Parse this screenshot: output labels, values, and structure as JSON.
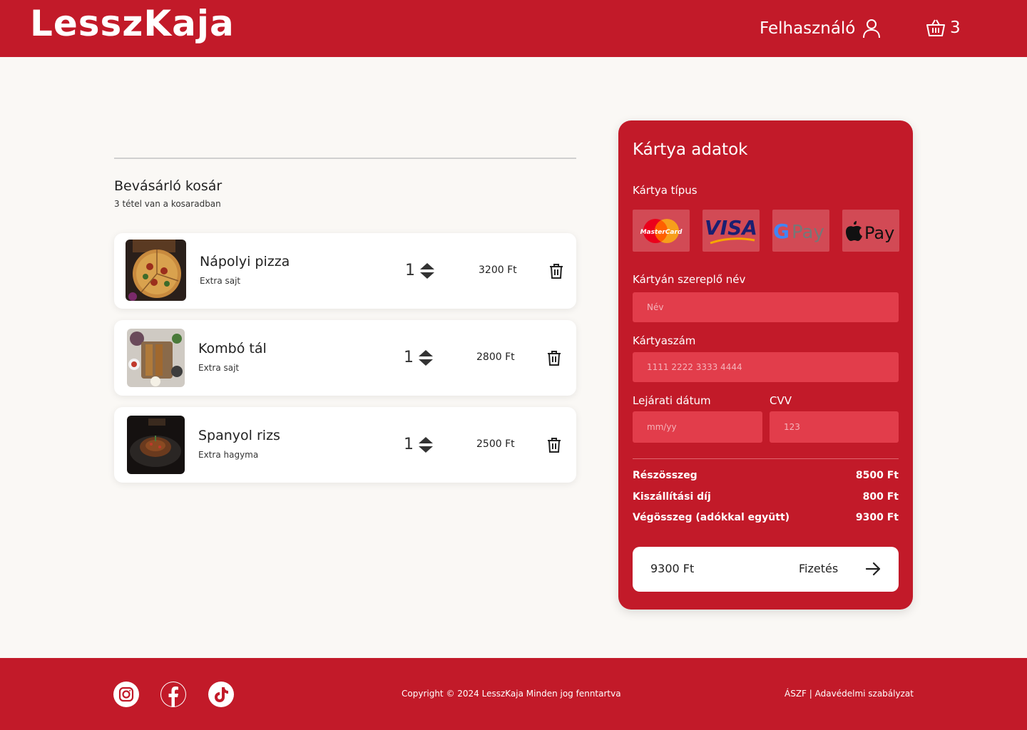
{
  "header": {
    "logo": "LesszKaja",
    "user_label": "Felhasználó",
    "cart_count": "3"
  },
  "cart": {
    "title": "Bevásárló kosár",
    "subtitle": "3 tétel van a kosaradban",
    "items": [
      {
        "name": "Nápolyi pizza",
        "extra": "Extra sajt",
        "qty": "1",
        "price": "3200 Ft",
        "image": "pizza-image"
      },
      {
        "name": "Kombó tál",
        "extra": "Extra sajt",
        "qty": "1",
        "price": "2800 Ft",
        "image": "combo-platter-image"
      },
      {
        "name": "Spanyol rizs",
        "extra": "Extra hagyma",
        "qty": "1",
        "price": "2500 Ft",
        "image": "spanish-rice-image"
      }
    ]
  },
  "payment": {
    "title": "Kártya adatok",
    "card_type_label": "Kártya típus",
    "card_types": [
      "MasterCard",
      "VISA",
      "G Pay",
      "Pay"
    ],
    "name_label": "Kártyán szereplő név",
    "name_placeholder": "Név",
    "number_label": "Kártyaszám",
    "number_placeholder": "1111 2222 3333 4444",
    "expiry_label": "Lejárati dátum",
    "expiry_placeholder": "mm/yy",
    "cvv_label": "CVV",
    "cvv_placeholder": "123",
    "subtotal_label": "Részösszeg",
    "subtotal_value": "8500 Ft",
    "delivery_label": "Kiszállítási díj",
    "delivery_value": "800 Ft",
    "total_label": "Végösszeg (adókkal együtt)",
    "total_value": "9300 Ft",
    "pay_total": "9300 Ft",
    "pay_label": "Fizetés"
  },
  "footer": {
    "copyright": "Copyright © 2024 LesszKaja Minden jog fenntartva",
    "terms": "ÁSZF",
    "separator": "|",
    "privacy": "Adavédelmi szabályzat"
  },
  "colors": {
    "brand": "#c21a29",
    "input_bg": "#e23d4b",
    "background": "#faf8f5"
  }
}
